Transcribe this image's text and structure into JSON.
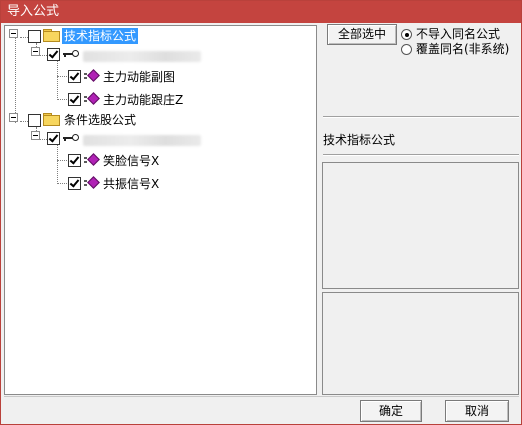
{
  "window": {
    "title": "导入公式"
  },
  "tree": {
    "groups": [
      {
        "label": "技术指标公式",
        "checked": false,
        "selected": true,
        "icon": "folder-icon",
        "author_row": {
          "checked": true,
          "icon": "key-icon",
          "items": [
            {
              "label": "主力动能副图",
              "checked": true,
              "icon": "formula-gem-icon"
            },
            {
              "label": "主力动能跟庄Z",
              "checked": true,
              "icon": "formula-gem-icon"
            }
          ]
        }
      },
      {
        "label": "条件选股公式",
        "checked": false,
        "selected": false,
        "icon": "folder-icon",
        "author_row": {
          "checked": true,
          "icon": "key-icon",
          "items": [
            {
              "label": "笑脸信号X",
              "checked": true,
              "icon": "formula-gem-icon"
            },
            {
              "label": "共振信号X",
              "checked": true,
              "icon": "formula-gem-icon"
            }
          ]
        }
      }
    ]
  },
  "options": {
    "select_all_label": "全部选中",
    "radios": [
      {
        "label": "不导入同名公式",
        "selected": true
      },
      {
        "label": "覆盖同名(非系统)",
        "selected": false
      }
    ]
  },
  "info": {
    "category_label": "技术指标公式"
  },
  "footer": {
    "ok_label": "确定",
    "cancel_label": "取消"
  },
  "colors": {
    "titlebar": "#c4443f",
    "selection": "#3399ff",
    "formula_icon": "#b022b5",
    "folder_icon": "#f7d65e"
  }
}
